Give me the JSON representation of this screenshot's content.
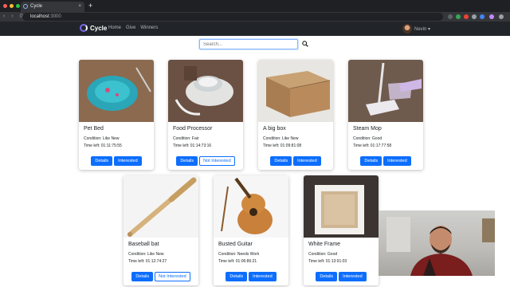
{
  "browser": {
    "tab_title": "Cycle",
    "tab_close": "×",
    "new_tab": "+",
    "nav_controls": "‹ › ⟳",
    "url_host": "localhost",
    "url_port": ":3000"
  },
  "nav": {
    "brand": "Cycle",
    "links": [
      "Home",
      "Give",
      "Winners"
    ],
    "user": "Nevin ▾"
  },
  "search": {
    "placeholder": "Search...",
    "button_icon": "search-icon"
  },
  "cards": [
    {
      "title": "Pet Bed",
      "condition": "Condition: Like New",
      "time_left": "Time left: 01:11:75:55",
      "details": "Details",
      "interest": "Interested",
      "interested": true
    },
    {
      "title": "Food Processor",
      "condition": "Condition: Fair",
      "time_left": "Time left: 01:14:73:16",
      "details": "Details",
      "interest": "Not Interested",
      "interested": false
    },
    {
      "title": "A big box",
      "condition": "Condition: Like New",
      "time_left": "Time left: 01:09:81:08",
      "details": "Details",
      "interest": "Interested",
      "interested": true
    },
    {
      "title": "Steam Mop",
      "condition": "Condition: Good",
      "time_left": "Time left: 01:17:77:58",
      "details": "Details",
      "interest": "Interested",
      "interested": true
    },
    {
      "title": "Baseball bat",
      "condition": "Condition: Like New",
      "time_left": "Time left: 01:12:74:27",
      "details": "Details",
      "interest": "Not Interested",
      "interested": false
    },
    {
      "title": "Busted Guitar",
      "condition": "Condition: Needs Work",
      "time_left": "Time left: 01:06:86:21",
      "details": "Details",
      "interest": "Interested",
      "interested": true
    },
    {
      "title": "White Frame",
      "condition": "Condition: Good",
      "time_left": "Time left: 01:13:91:03",
      "details": "Details",
      "interest": "Interested",
      "interested": true
    }
  ],
  "colors": {
    "primary": "#0d6efd",
    "navbar": "#212529",
    "chrome_dark": "#1f2023"
  }
}
